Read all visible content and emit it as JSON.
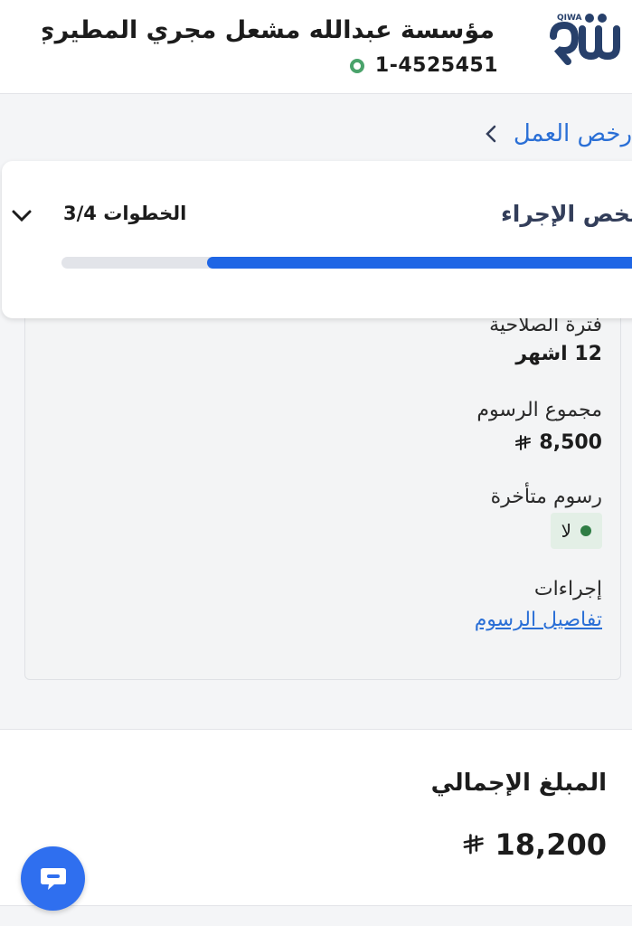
{
  "header": {
    "logo_text": "QIWA",
    "company_name": "مؤسسة عبدالله مشعل مجري المطيري...",
    "company_id": "1-4525451"
  },
  "nav": {
    "back_label": "رخص العمل"
  },
  "stepper": {
    "title": "ملخص الإجراء",
    "steps_label": "الخطوات 3/4",
    "progress": 0.75
  },
  "details": {
    "validity_label": "فترة الصلاحية",
    "validity_value": "12 اشهر",
    "total_fees_label": "مجموع الرسوم",
    "total_fees_value": "8,500",
    "late_fees_label": "رسوم متأخرة",
    "late_fees_value": "لا",
    "actions_label": "إجراءات",
    "fees_details_link": "تفاصيل الرسوم"
  },
  "total": {
    "label": "المبلغ الإجمالي",
    "value": "18,200"
  },
  "colors": {
    "accent_blue": "#1f66e5",
    "link_blue": "#2a6fd6",
    "status_green": "#2f7d44"
  },
  "icons": {
    "back": "chevron-left-icon",
    "toggle": "chevron-down-icon",
    "currency": "riyal-icon",
    "chat": "chat-icon"
  }
}
